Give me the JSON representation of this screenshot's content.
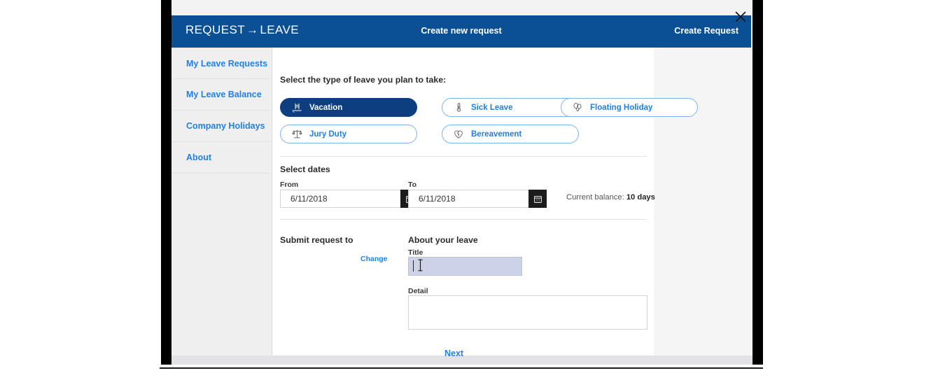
{
  "header": {
    "brand_left": "REQUEST",
    "brand_arrow": "→",
    "brand_right": "LEAVE",
    "title": "Create new request",
    "create_request_label": "Create Request",
    "close_icon": "close-icon",
    "background_color": "#0b5094"
  },
  "sidebar": {
    "items": [
      {
        "label": "My Leave Requests"
      },
      {
        "label": "My Leave Balance"
      },
      {
        "label": "Company Holidays"
      },
      {
        "label": "About"
      }
    ],
    "link_color": "#2180e8"
  },
  "main": {
    "prompt": "Select the type of leave you plan to take:",
    "leave_types": [
      {
        "label": "Vacation",
        "icon": "pool-ladder-icon",
        "selected": true
      },
      {
        "label": "Sick Leave",
        "icon": "thermometer-icon",
        "selected": false
      },
      {
        "label": "Floating Holiday",
        "icon": "balloons-icon",
        "selected": false
      },
      {
        "label": "Jury Duty",
        "icon": "scales-icon",
        "selected": false
      },
      {
        "label": "Bereavement",
        "icon": "broken-heart-icon",
        "selected": false
      }
    ],
    "dates": {
      "heading": "Select dates",
      "from_label": "From",
      "from_value": "6/11/2018",
      "to_label": "To",
      "to_value": "6/11/2018",
      "calendar_icon": "calendar-icon",
      "balance_prefix": "Current balance:",
      "balance_value": "10 days"
    },
    "submit_to": {
      "heading": "Submit request to",
      "change_label": "Change"
    },
    "about_leave": {
      "heading": "About your leave",
      "title_label": "Title",
      "title_value": "",
      "title_placeholder": "",
      "detail_label": "Detail",
      "detail_value": "",
      "detail_placeholder": ""
    },
    "next_label": "Next",
    "selected_pill_color": "#0d3f80",
    "pill_border_color": "#7cb3ef",
    "focus_field_color": "#ccd3e8"
  }
}
